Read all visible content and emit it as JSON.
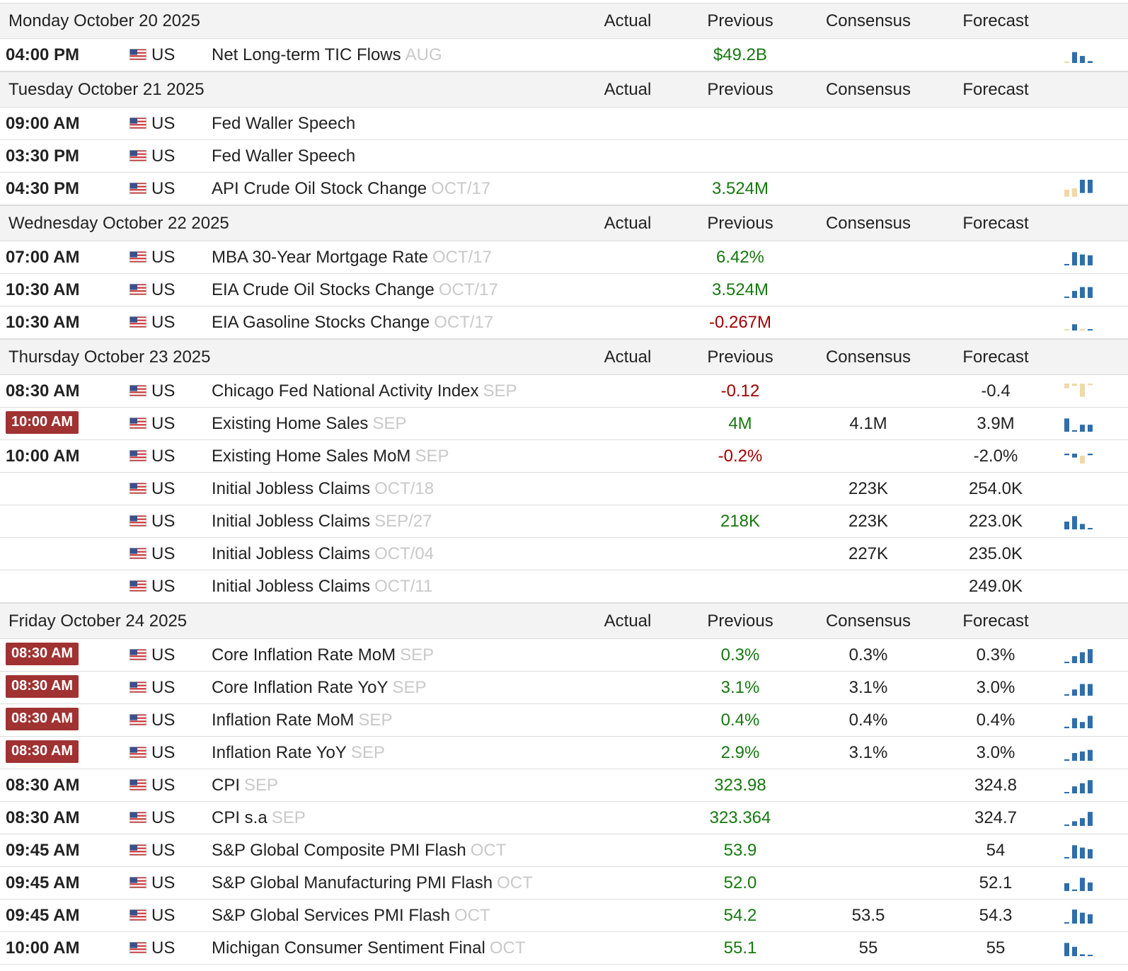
{
  "columns": {
    "actual": "Actual",
    "previous": "Previous",
    "consensus": "Consensus",
    "forecast": "Forecast"
  },
  "colors": {
    "positive": "#16780f",
    "negative": "#a00000",
    "highlight": "#a03232",
    "spark_blue": "#2f6eaa",
    "spark_tan": "#f0d9a8"
  },
  "days": [
    {
      "date": "Monday October 20 2025",
      "events": [
        {
          "time": "04:00 PM",
          "hl": false,
          "country": "US",
          "name": "Net Long-term TIC Flows",
          "ref": "AUG",
          "actual": "",
          "previous": "$49.2B",
          "prev_tone": "pos",
          "consensus": "",
          "forecast": "",
          "spark": "spark-a"
        }
      ]
    },
    {
      "date": "Tuesday October 21 2025",
      "events": [
        {
          "time": "09:00 AM",
          "hl": false,
          "country": "US",
          "name": "Fed Waller Speech",
          "ref": "",
          "actual": "",
          "previous": "",
          "prev_tone": "neu",
          "consensus": "",
          "forecast": "",
          "spark": ""
        },
        {
          "time": "03:30 PM",
          "hl": false,
          "country": "US",
          "name": "Fed Waller Speech",
          "ref": "",
          "actual": "",
          "previous": "",
          "prev_tone": "neu",
          "consensus": "",
          "forecast": "",
          "spark": ""
        },
        {
          "time": "04:30 PM",
          "hl": false,
          "country": "US",
          "name": "API Crude Oil Stock Change",
          "ref": "OCT/17",
          "actual": "",
          "previous": "3.524M",
          "prev_tone": "pos",
          "consensus": "",
          "forecast": "",
          "spark": "spark-b"
        }
      ]
    },
    {
      "date": "Wednesday October 22 2025",
      "events": [
        {
          "time": "07:00 AM",
          "hl": false,
          "country": "US",
          "name": "MBA 30-Year Mortgage Rate",
          "ref": "OCT/17",
          "actual": "",
          "previous": "6.42%",
          "prev_tone": "pos",
          "consensus": "",
          "forecast": "",
          "spark": "spark-c"
        },
        {
          "time": "10:30 AM",
          "hl": false,
          "country": "US",
          "name": "EIA Crude Oil Stocks Change",
          "ref": "OCT/17",
          "actual": "",
          "previous": "3.524M",
          "prev_tone": "pos",
          "consensus": "",
          "forecast": "",
          "spark": "spark-d"
        },
        {
          "time": "10:30 AM",
          "hl": false,
          "country": "US",
          "name": "EIA Gasoline Stocks Change",
          "ref": "OCT/17",
          "actual": "",
          "previous": "-0.267M",
          "prev_tone": "neg",
          "consensus": "",
          "forecast": "",
          "spark": "spark-e"
        }
      ]
    },
    {
      "date": "Thursday October 23 2025",
      "events": [
        {
          "time": "08:30 AM",
          "hl": false,
          "country": "US",
          "name": "Chicago Fed National Activity Index",
          "ref": "SEP",
          "actual": "",
          "previous": "-0.12",
          "prev_tone": "neg",
          "consensus": "",
          "forecast": "-0.4",
          "spark": "spark-f"
        },
        {
          "time": "10:00 AM",
          "hl": true,
          "country": "US",
          "name": "Existing Home Sales",
          "ref": "SEP",
          "actual": "",
          "previous": "4M",
          "prev_tone": "pos",
          "consensus": "4.1M",
          "forecast": "3.9M",
          "spark": "spark-g"
        },
        {
          "time": "10:00 AM",
          "hl": false,
          "country": "US",
          "name": "Existing Home Sales MoM",
          "ref": "SEP",
          "actual": "",
          "previous": "-0.2%",
          "prev_tone": "neg",
          "consensus": "",
          "forecast": "-2.0%",
          "spark": "spark-h"
        },
        {
          "time": "",
          "hl": false,
          "country": "US",
          "name": "Initial Jobless Claims",
          "ref": "OCT/18",
          "actual": "",
          "previous": "",
          "prev_tone": "neu",
          "consensus": "223K",
          "forecast": "254.0K",
          "spark": ""
        },
        {
          "time": "",
          "hl": false,
          "country": "US",
          "name": "Initial Jobless Claims",
          "ref": "SEP/27",
          "actual": "",
          "previous": "218K",
          "prev_tone": "pos",
          "consensus": "223K",
          "forecast": "223.0K",
          "spark": "spark-i"
        },
        {
          "time": "",
          "hl": false,
          "country": "US",
          "name": "Initial Jobless Claims",
          "ref": "OCT/04",
          "actual": "",
          "previous": "",
          "prev_tone": "neu",
          "consensus": "227K",
          "forecast": "235.0K",
          "spark": ""
        },
        {
          "time": "",
          "hl": false,
          "country": "US",
          "name": "Initial Jobless Claims",
          "ref": "OCT/11",
          "actual": "",
          "previous": "",
          "prev_tone": "neu",
          "consensus": "",
          "forecast": "249.0K",
          "spark": ""
        }
      ]
    },
    {
      "date": "Friday October 24 2025",
      "events": [
        {
          "time": "08:30 AM",
          "hl": true,
          "country": "US",
          "name": "Core Inflation Rate MoM",
          "ref": "SEP",
          "actual": "",
          "previous": "0.3%",
          "prev_tone": "pos",
          "consensus": "0.3%",
          "forecast": "0.3%",
          "spark": "spark-j"
        },
        {
          "time": "08:30 AM",
          "hl": true,
          "country": "US",
          "name": "Core Inflation Rate YoY",
          "ref": "SEP",
          "actual": "",
          "previous": "3.1%",
          "prev_tone": "pos",
          "consensus": "3.1%",
          "forecast": "3.0%",
          "spark": "spark-k"
        },
        {
          "time": "08:30 AM",
          "hl": true,
          "country": "US",
          "name": "Inflation Rate MoM",
          "ref": "SEP",
          "actual": "",
          "previous": "0.4%",
          "prev_tone": "pos",
          "consensus": "0.4%",
          "forecast": "0.4%",
          "spark": "spark-l"
        },
        {
          "time": "08:30 AM",
          "hl": true,
          "country": "US",
          "name": "Inflation Rate YoY",
          "ref": "SEP",
          "actual": "",
          "previous": "2.9%",
          "prev_tone": "pos",
          "consensus": "3.1%",
          "forecast": "3.0%",
          "spark": "spark-m"
        },
        {
          "time": "08:30 AM",
          "hl": false,
          "country": "US",
          "name": "CPI",
          "ref": "SEP",
          "actual": "",
          "previous": "323.98",
          "prev_tone": "pos",
          "consensus": "",
          "forecast": "324.8",
          "spark": "spark-n"
        },
        {
          "time": "08:30 AM",
          "hl": false,
          "country": "US",
          "name": "CPI s.a",
          "ref": "SEP",
          "actual": "",
          "previous": "323.364",
          "prev_tone": "pos",
          "consensus": "",
          "forecast": "324.7",
          "spark": "spark-o"
        },
        {
          "time": "09:45 AM",
          "hl": false,
          "country": "US",
          "name": "S&P Global Composite PMI Flash",
          "ref": "OCT",
          "actual": "",
          "previous": "53.9",
          "prev_tone": "pos",
          "consensus": "",
          "forecast": "54",
          "spark": "spark-p"
        },
        {
          "time": "09:45 AM",
          "hl": false,
          "country": "US",
          "name": "S&P Global Manufacturing PMI Flash",
          "ref": "OCT",
          "actual": "",
          "previous": "52.0",
          "prev_tone": "pos",
          "consensus": "",
          "forecast": "52.1",
          "spark": "spark-q"
        },
        {
          "time": "09:45 AM",
          "hl": false,
          "country": "US",
          "name": "S&P Global Services PMI Flash",
          "ref": "OCT",
          "actual": "",
          "previous": "54.2",
          "prev_tone": "pos",
          "consensus": "53.5",
          "forecast": "54.3",
          "spark": "spark-r"
        },
        {
          "time": "10:00 AM",
          "hl": false,
          "country": "US",
          "name": "Michigan Consumer Sentiment Final",
          "ref": "OCT",
          "actual": "",
          "previous": "55.1",
          "prev_tone": "pos",
          "consensus": "55",
          "forecast": "55",
          "spark": "spark-s"
        }
      ]
    }
  ],
  "sparklines": {
    "spark-a": [
      {
        "v": 0.05,
        "c": "tan"
      },
      {
        "v": 0.7,
        "c": "blue"
      },
      {
        "v": 0.45,
        "c": "blue"
      },
      {
        "v": 0.12,
        "c": "blue"
      }
    ],
    "spark-b": [
      {
        "v": 0.45,
        "c": "tan"
      },
      {
        "v": 0.55,
        "c": "tan"
      },
      {
        "v": 0.85,
        "c": "blue",
        "float": true
      },
      {
        "v": 0.85,
        "c": "blue",
        "float": true
      }
    ],
    "spark-c": [
      {
        "v": 0.08,
        "c": "blue"
      },
      {
        "v": 0.85,
        "c": "blue"
      },
      {
        "v": 0.7,
        "c": "blue"
      },
      {
        "v": 0.65,
        "c": "blue"
      }
    ],
    "spark-d": [
      {
        "v": 0.08,
        "c": "blue"
      },
      {
        "v": 0.45,
        "c": "blue"
      },
      {
        "v": 0.7,
        "c": "blue"
      },
      {
        "v": 0.7,
        "c": "blue"
      }
    ],
    "spark-e": [
      {
        "v": 0.05,
        "c": "tan"
      },
      {
        "v": 0.4,
        "c": "blue"
      },
      {
        "v": 0.1,
        "c": "tan"
      },
      {
        "v": 0.08,
        "c": "blue"
      }
    ],
    "spark-f": [
      {
        "v": 0.3,
        "c": "tan",
        "top": true
      },
      {
        "v": 0.15,
        "c": "tan",
        "top": true
      },
      {
        "v": 0.85,
        "c": "tan",
        "top": true
      },
      {
        "v": 0.1,
        "c": "tan",
        "top": true
      }
    ],
    "spark-g": [
      {
        "v": 0.85,
        "c": "blue"
      },
      {
        "v": 0.1,
        "c": "blue"
      },
      {
        "v": 0.45,
        "c": "blue"
      },
      {
        "v": 0.45,
        "c": "blue"
      }
    ],
    "spark-h": [
      {
        "v": 0.1,
        "c": "blue",
        "mid": true
      },
      {
        "v": 0.25,
        "c": "blue",
        "mid": true
      },
      {
        "v": 0.5,
        "c": "tan",
        "midlow": true
      },
      {
        "v": 0.1,
        "c": "blue",
        "mid": true
      }
    ],
    "spark-i": [
      {
        "v": 0.5,
        "c": "blue"
      },
      {
        "v": 0.85,
        "c": "blue"
      },
      {
        "v": 0.35,
        "c": "blue"
      },
      {
        "v": 0.06,
        "c": "blue"
      }
    ],
    "spark-j": [
      {
        "v": 0.08,
        "c": "blue"
      },
      {
        "v": 0.45,
        "c": "blue"
      },
      {
        "v": 0.7,
        "c": "blue"
      },
      {
        "v": 0.9,
        "c": "blue"
      }
    ],
    "spark-k": [
      {
        "v": 0.08,
        "c": "blue"
      },
      {
        "v": 0.4,
        "c": "blue"
      },
      {
        "v": 0.75,
        "c": "blue"
      },
      {
        "v": 0.75,
        "c": "blue"
      }
    ],
    "spark-l": [
      {
        "v": 0.1,
        "c": "blue"
      },
      {
        "v": 0.65,
        "c": "blue"
      },
      {
        "v": 0.4,
        "c": "blue"
      },
      {
        "v": 0.8,
        "c": "blue"
      }
    ],
    "spark-m": [
      {
        "v": 0.1,
        "c": "blue"
      },
      {
        "v": 0.5,
        "c": "blue"
      },
      {
        "v": 0.6,
        "c": "blue"
      },
      {
        "v": 0.7,
        "c": "blue"
      }
    ],
    "spark-n": [
      {
        "v": 0.08,
        "c": "blue"
      },
      {
        "v": 0.45,
        "c": "blue"
      },
      {
        "v": 0.65,
        "c": "blue"
      },
      {
        "v": 0.85,
        "c": "blue"
      }
    ],
    "spark-o": [
      {
        "v": 0.08,
        "c": "blue"
      },
      {
        "v": 0.3,
        "c": "blue"
      },
      {
        "v": 0.5,
        "c": "blue"
      },
      {
        "v": 0.9,
        "c": "blue"
      }
    ],
    "spark-p": [
      {
        "v": 0.08,
        "c": "blue"
      },
      {
        "v": 0.85,
        "c": "blue"
      },
      {
        "v": 0.7,
        "c": "blue"
      },
      {
        "v": 0.6,
        "c": "blue"
      }
    ],
    "spark-q": [
      {
        "v": 0.5,
        "c": "blue"
      },
      {
        "v": 0.1,
        "c": "blue"
      },
      {
        "v": 0.85,
        "c": "blue"
      },
      {
        "v": 0.55,
        "c": "blue"
      }
    ],
    "spark-r": [
      {
        "v": 0.08,
        "c": "blue"
      },
      {
        "v": 0.9,
        "c": "blue"
      },
      {
        "v": 0.7,
        "c": "blue"
      },
      {
        "v": 0.6,
        "c": "blue"
      }
    ],
    "spark-s": [
      {
        "v": 0.85,
        "c": "blue"
      },
      {
        "v": 0.6,
        "c": "blue"
      },
      {
        "v": 0.12,
        "c": "blue"
      },
      {
        "v": 0.08,
        "c": "blue"
      }
    ]
  }
}
